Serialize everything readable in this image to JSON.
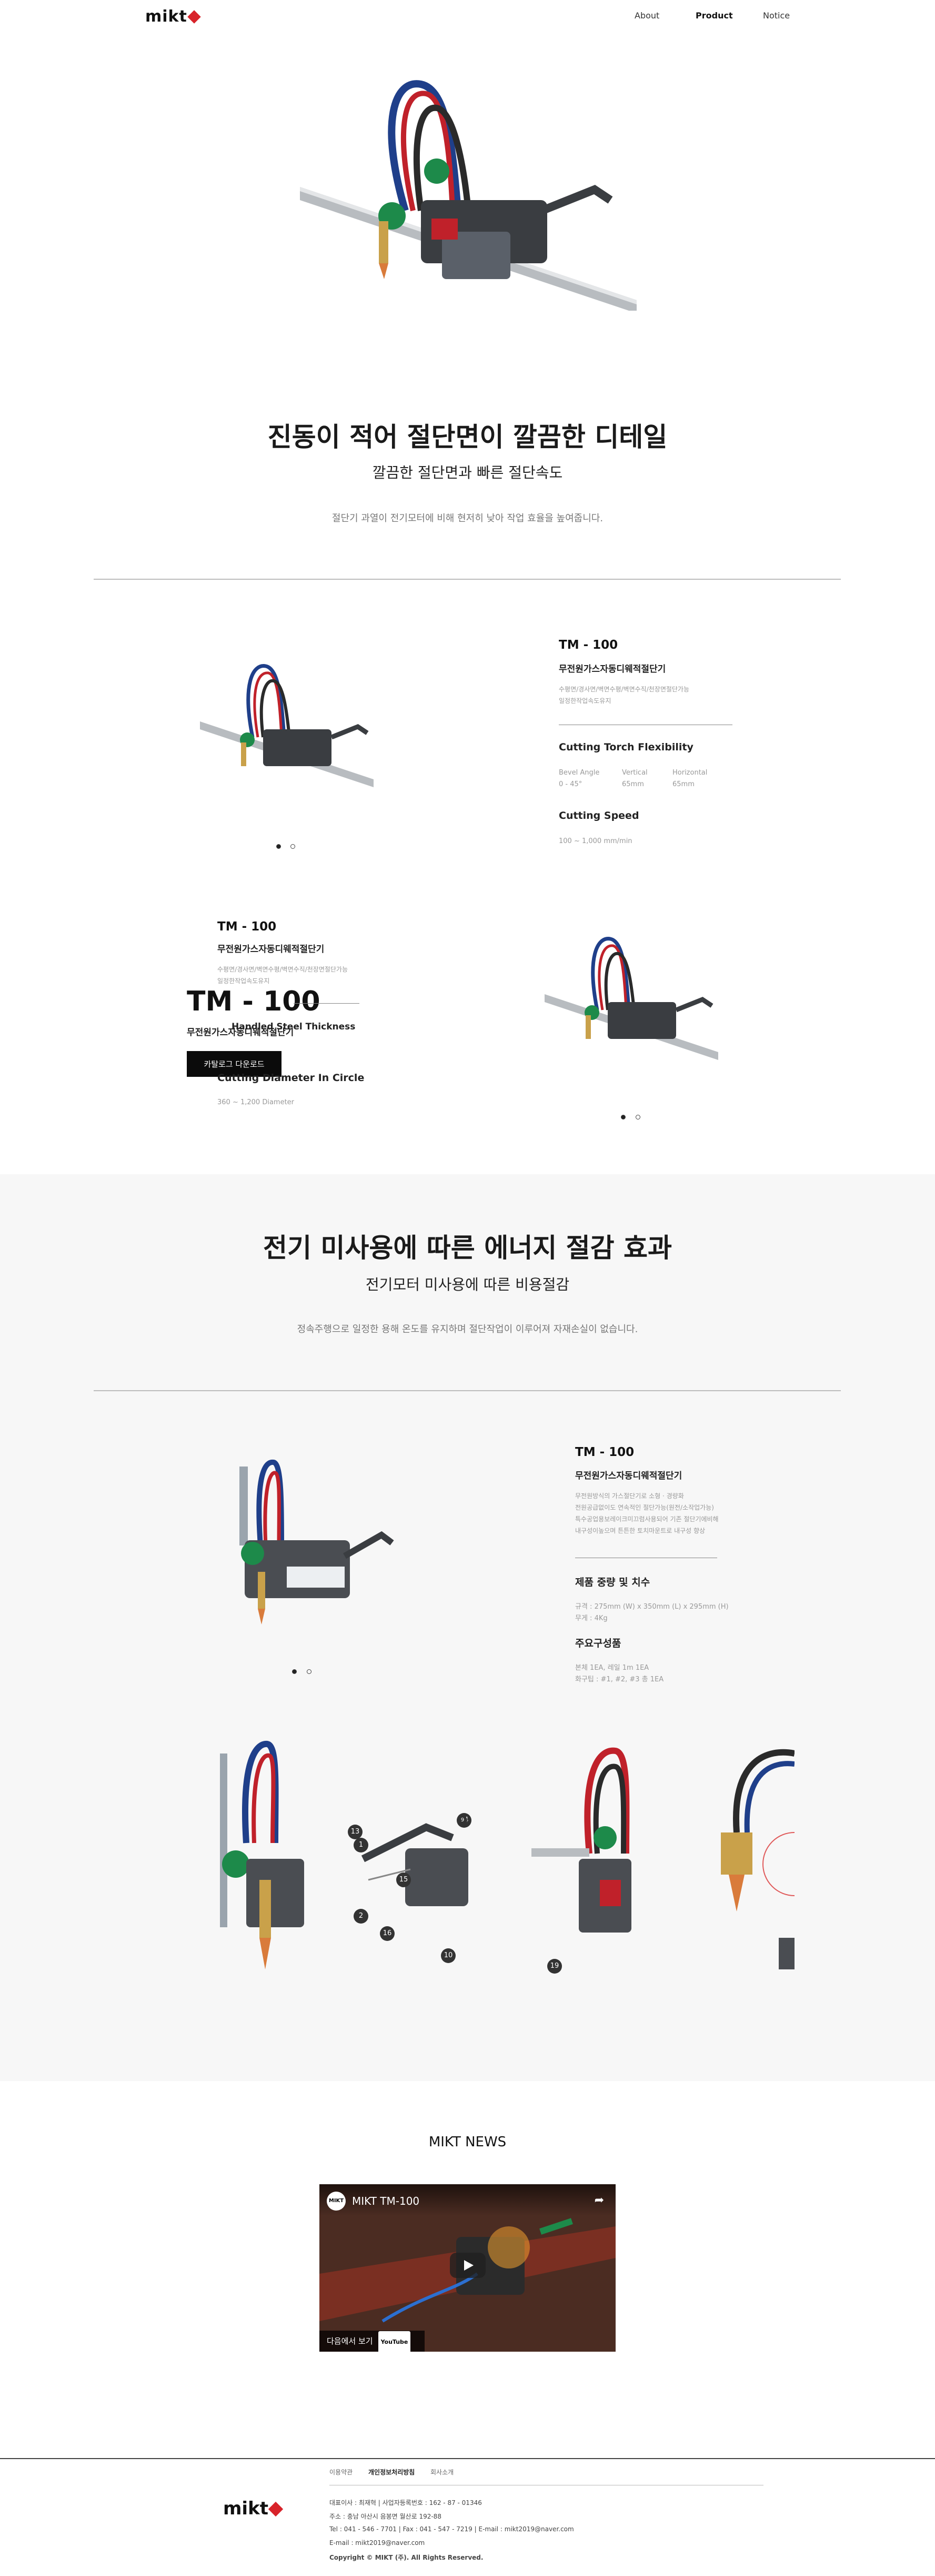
{
  "header": {
    "logo": "mikt",
    "nav": [
      "About",
      "Product",
      "Notice"
    ]
  },
  "section1": {
    "title": "진동이 적어 절단면이 깔끔한 디테일",
    "subtitle": "깔끔한 절단면과 빠른 절단속도",
    "desc": "절단기 과열이 전기모터에 비해 현저히 낮아 작업 효율을 높여줍니다."
  },
  "spec1": {
    "model": "TM - 100",
    "name": "무전원가스자동디웨적절단기",
    "desc_lines": [
      "수평면/경사면/벽면수평/벽면수직/천장면절단가능",
      "일정한작업속도유지"
    ],
    "flex_title": "Cutting Torch Flexibility",
    "flex_cols": [
      {
        "label": "Bevel Angle",
        "value": "0 - 45°"
      },
      {
        "label": "Vertical",
        "value": "65mm"
      },
      {
        "label": "Horizontal",
        "value": "65mm"
      }
    ],
    "speed_title": "Cutting Speed",
    "speed_value": "100 ~ 1,000 mm/min"
  },
  "spec2": {
    "model": "TM - 100",
    "name": "무전원가스자동디웨적절단기",
    "desc_lines": [
      "수평면/경사면/벽면수평/벽면수직/천장면절단가능",
      "일정한작업속도유지"
    ],
    "overlay_model": "TM - 100",
    "overlay_name": "무전원가스자동디웨적절단기",
    "thick_title": "Handled Steel Thickness",
    "catalog_button": "카탈로그 다운로드",
    "circle_title": "Cutting Diameter In Circle",
    "circle_value": "360 ~ 1,200 Diameter"
  },
  "section2": {
    "title": "전기 미사용에 따른 에너지 절감 효과",
    "subtitle": "전기모터 미사용에 따른 비용절감",
    "desc": "정속주행으로 일정한 용해 온도를 유지하며 절단작업이 이루어져 자재손실이 없습니다."
  },
  "spec3": {
    "model": "TM - 100",
    "name": "무전원가스자동디웨적절단기",
    "desc_lines": [
      "무전원방식의 가스절단기로 소형 · 경량화",
      "전원공급없이도 연속적인 절단가능(원전/소작업가능)",
      "특수공업용보레이크미끄럼사용되어 기존 절단기에비해",
      "내구성이높으며 튼튼한 토치마운트로 내구성 향상"
    ],
    "weight_title": "제품 중량 및 치수",
    "weight_lines": [
      "규격 : 275mm (W) x 350mm (L) x 295mm (H)",
      "무게 : 4Kg"
    ],
    "parts_title": "주요구성품",
    "parts_lines": [
      "본체 1EA, 레일 1m 1EA",
      "화구팁 : #1, #2, #3 총 1EA"
    ]
  },
  "detail_callouts": [
    "13",
    "14",
    "1",
    "15",
    "2",
    "16",
    "10",
    "19",
    "9"
  ],
  "news": {
    "title": "MIKT NEWS",
    "video_title": "MIKT TM-100",
    "channel_badge": "MIKT",
    "watch_label": "다음에서 보기",
    "youtube_label": "YouTube"
  },
  "footer": {
    "logo": "mikt",
    "links": [
      "이용약관",
      "개인정보처리방침",
      "회사소개"
    ],
    "info": [
      "대표이사 : 최재혁  |  사업자등록번호 : 162 - 87 - 01346",
      "주소 : 충남 아산시 음봉면 월산로 192-88",
      "Tel : 041 - 546 - 7701  |  Fax : 041 - 547 - 7219  |  E-mail : mikt2019@naver.com",
      "E-mail : mikt2019@naver.com",
      "Copyright © MIKT (주). All Rights Reserved."
    ]
  },
  "colors": {
    "accent_red": "#d8232a",
    "grey_bg": "#f7f7f7",
    "hose_blue": "#1f3f8a",
    "hose_red": "#c0212a",
    "valve_green": "#1d8a4a"
  }
}
